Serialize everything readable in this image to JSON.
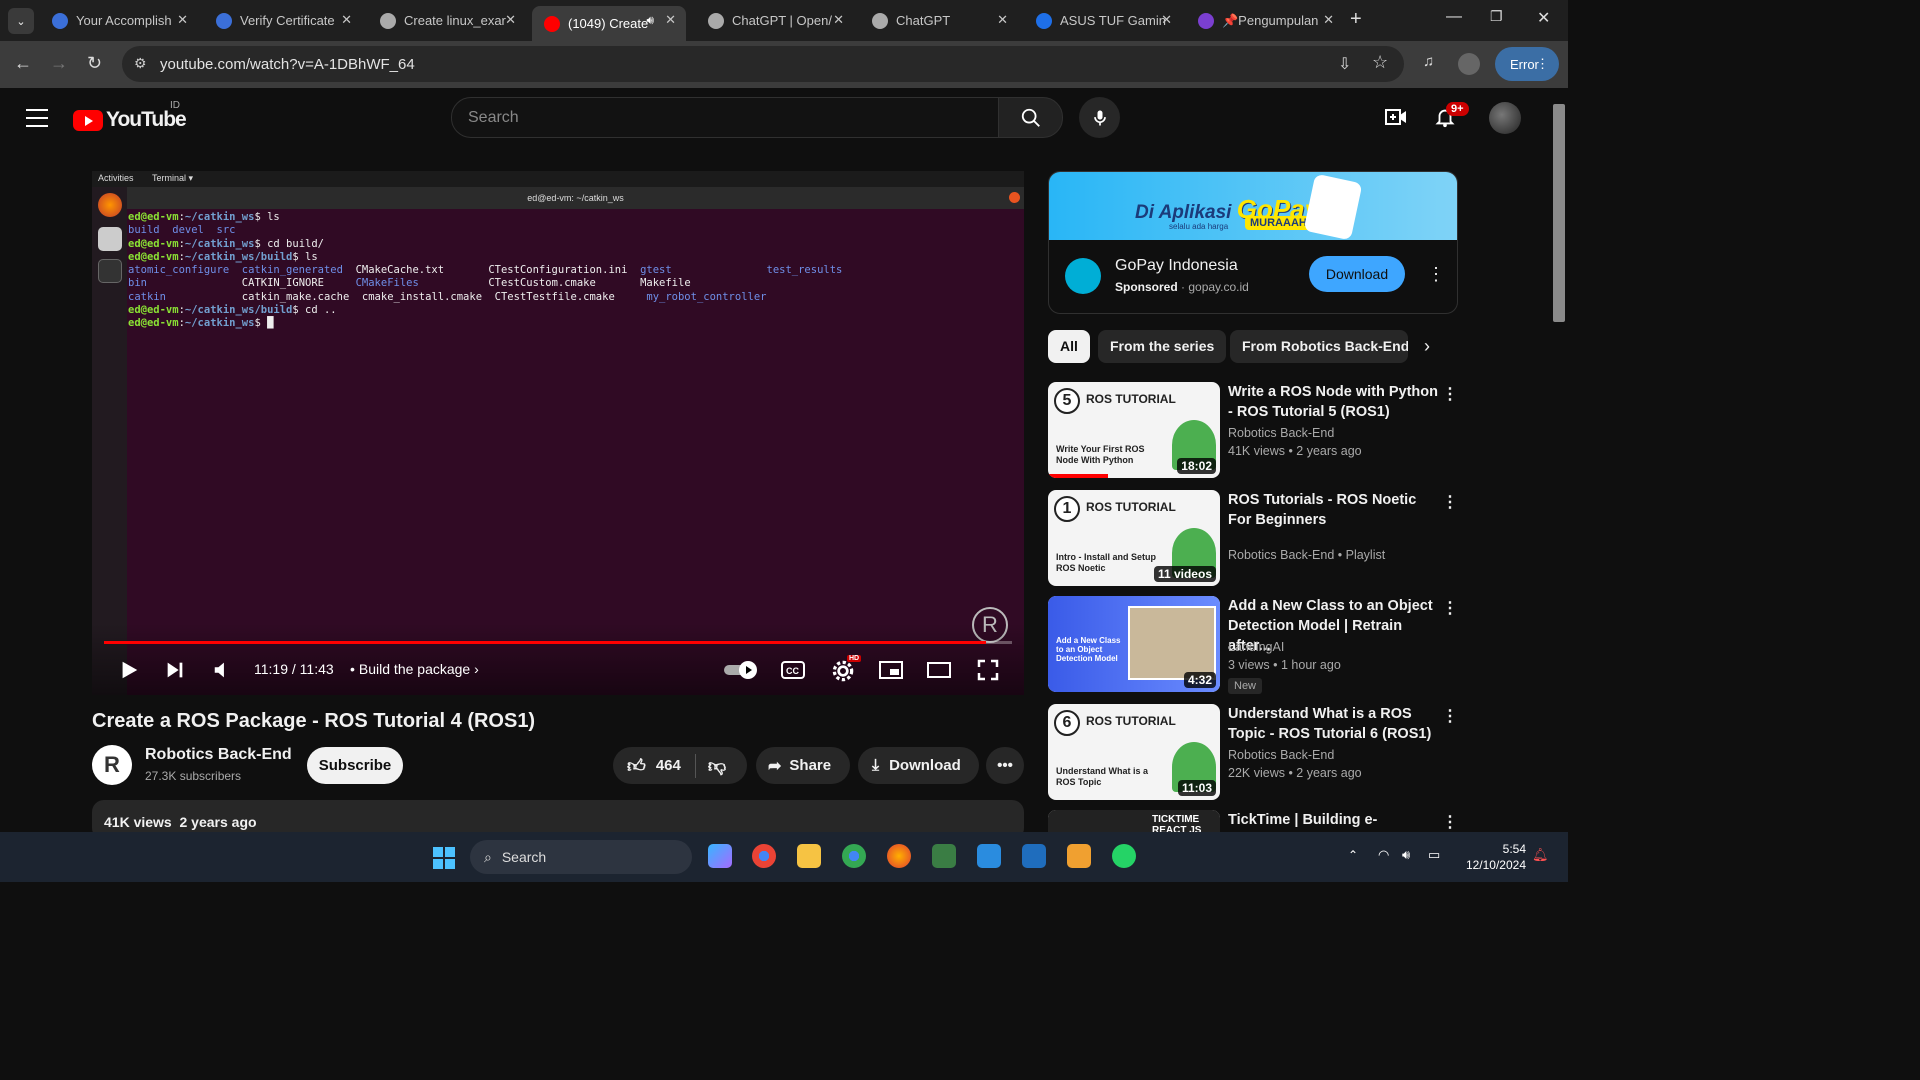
{
  "browser": {
    "tabs": [
      {
        "title": "Your Accomplish",
        "favicon_color": "#3b6fd8"
      },
      {
        "title": "Verify Certificate",
        "favicon_color": "#3b6fd8"
      },
      {
        "title": "Create linux_exar",
        "favicon_color": "#aaaaaa"
      },
      {
        "title": "(1049) Create",
        "favicon_color": "#ff0000",
        "active": true
      },
      {
        "title": "ChatGPT | Open/",
        "favicon_color": "#aaaaaa"
      },
      {
        "title": "ChatGPT",
        "favicon_color": "#aaaaaa"
      },
      {
        "title": "ASUS TUF Gamin",
        "favicon_color": "#1e6fe8"
      },
      {
        "title": "📌Pengumpulan",
        "favicon_color": "#7b3fd0"
      }
    ],
    "url": "youtube.com/watch?v=A-1DBhWF_64",
    "error_label": "Error"
  },
  "youtube": {
    "logo_text": "YouTube",
    "country_code": "ID",
    "search_placeholder": "Search",
    "notif_count": "9+"
  },
  "player": {
    "ubuntu_bar": {
      "activities": "Activities",
      "app": "Terminal ▾"
    },
    "terminal_title": "ed@ed-vm: ~/catkin_ws",
    "terminal_lines": [
      [
        {
          "t": "ed@ed-vm",
          "c": "g"
        },
        {
          "t": ":",
          "c": ""
        },
        {
          "t": "~/catkin_ws",
          "c": "b"
        },
        {
          "t": "$ ls",
          "c": ""
        }
      ],
      [
        {
          "t": "build  devel  src",
          "c": "bl"
        }
      ],
      [
        {
          "t": "ed@ed-vm",
          "c": "g"
        },
        {
          "t": ":",
          "c": ""
        },
        {
          "t": "~/catkin_ws",
          "c": "b"
        },
        {
          "t": "$ cd build/",
          "c": ""
        }
      ],
      [
        {
          "t": "ed@ed-vm",
          "c": "g"
        },
        {
          "t": ":",
          "c": ""
        },
        {
          "t": "~/catkin_ws/build",
          "c": "b"
        },
        {
          "t": "$ ls",
          "c": ""
        }
      ],
      [
        {
          "t": "atomic_configure  catkin_generated  ",
          "c": "bl"
        },
        {
          "t": "CMakeCache.txt       CTestConfiguration.ini  ",
          "c": ""
        },
        {
          "t": "gtest               test_results",
          "c": "bl"
        }
      ],
      [
        {
          "t": "bin               ",
          "c": "bl"
        },
        {
          "t": "CATKIN_IGNORE     ",
          "c": ""
        },
        {
          "t": "CMakeFiles           ",
          "c": "bl"
        },
        {
          "t": "CTestCustom.cmake       Makefile",
          "c": ""
        }
      ],
      [
        {
          "t": "catkin            ",
          "c": "bl"
        },
        {
          "t": "catkin_make.cache  cmake_install.cmake  CTestTestfile.cmake     ",
          "c": ""
        },
        {
          "t": "my_robot_controller",
          "c": "bl"
        }
      ],
      [
        {
          "t": "ed@ed-vm",
          "c": "g"
        },
        {
          "t": ":",
          "c": ""
        },
        {
          "t": "~/catkin_ws/build",
          "c": "b"
        },
        {
          "t": "$ cd ..",
          "c": ""
        }
      ],
      [
        {
          "t": "ed@ed-vm",
          "c": "g"
        },
        {
          "t": ":",
          "c": ""
        },
        {
          "t": "~/catkin_ws",
          "c": "b"
        },
        {
          "t": "$ █",
          "c": ""
        }
      ]
    ],
    "time": "11:19 / 11:43",
    "chapter": "Build the package",
    "progress": 0.9713,
    "settings_badge": "HD"
  },
  "video": {
    "title": "Create a ROS Package - ROS Tutorial 4 (ROS1)",
    "channel": "Robotics Back-End",
    "subscribers": "27.3K subscribers",
    "subscribe_label": "Subscribe",
    "likes": "464",
    "share_label": "Share",
    "download_label": "Download",
    "views": "41K views",
    "age": "2 years ago"
  },
  "ad": {
    "slogan_pre": "Di Aplikasi",
    "slogan_brand": "GoPay",
    "slogan_tag": "MURAAAH",
    "slogan_small": "selalu ada harga",
    "name": "GoPay Indonesia",
    "sponsored": "Sponsored",
    "domain": "gopay.co.id",
    "download_label": "Download"
  },
  "chips": [
    "All",
    "From the series",
    "From Robotics Back-End"
  ],
  "recommendations": [
    {
      "thumb_num": "5",
      "thumb_title": "ROS TUTORIAL",
      "thumb_sub": "Write Your First ROS Node With Python",
      "duration": "18:02",
      "title": "Write a ROS Node with Python - ROS Tutorial 5 (ROS1)",
      "channel": "Robotics Back-End",
      "meta": "41K views • 2 years ago"
    },
    {
      "thumb_num": "1",
      "thumb_title": "ROS TUTORIAL",
      "thumb_sub": "Intro - Install and Setup ROS Noetic",
      "duration": "11 videos",
      "title": "ROS Tutorials - ROS Noetic For Beginners",
      "channel": "Robotics Back-End • Playlist",
      "meta": ""
    },
    {
      "thumb_num": "",
      "thumb_title": "",
      "thumb_sub": "Add a New Class to an Object Detection Model",
      "duration": "4:32",
      "title": "Add a New Class to an Object Detection Model | Retrain after...",
      "channel": "LandingAI",
      "meta": "3 views • 1 hour ago",
      "badge": "New"
    },
    {
      "thumb_num": "6",
      "thumb_title": "ROS TUTORIAL",
      "thumb_sub": "Understand What is a ROS Topic",
      "duration": "11:03",
      "title": "Understand What is a ROS Topic - ROS Tutorial 6 (ROS1)",
      "channel": "Robotics Back-End",
      "meta": "22K views • 2 years ago"
    },
    {
      "thumb_num": "",
      "thumb_title": "TICKTIME REACT JS",
      "thumb_sub": "",
      "duration": "",
      "title": "TickTime | Building e-",
      "channel": "",
      "meta": ""
    }
  ],
  "taskbar": {
    "search_label": "Search",
    "time": "5:54",
    "date": "12/10/2024"
  }
}
